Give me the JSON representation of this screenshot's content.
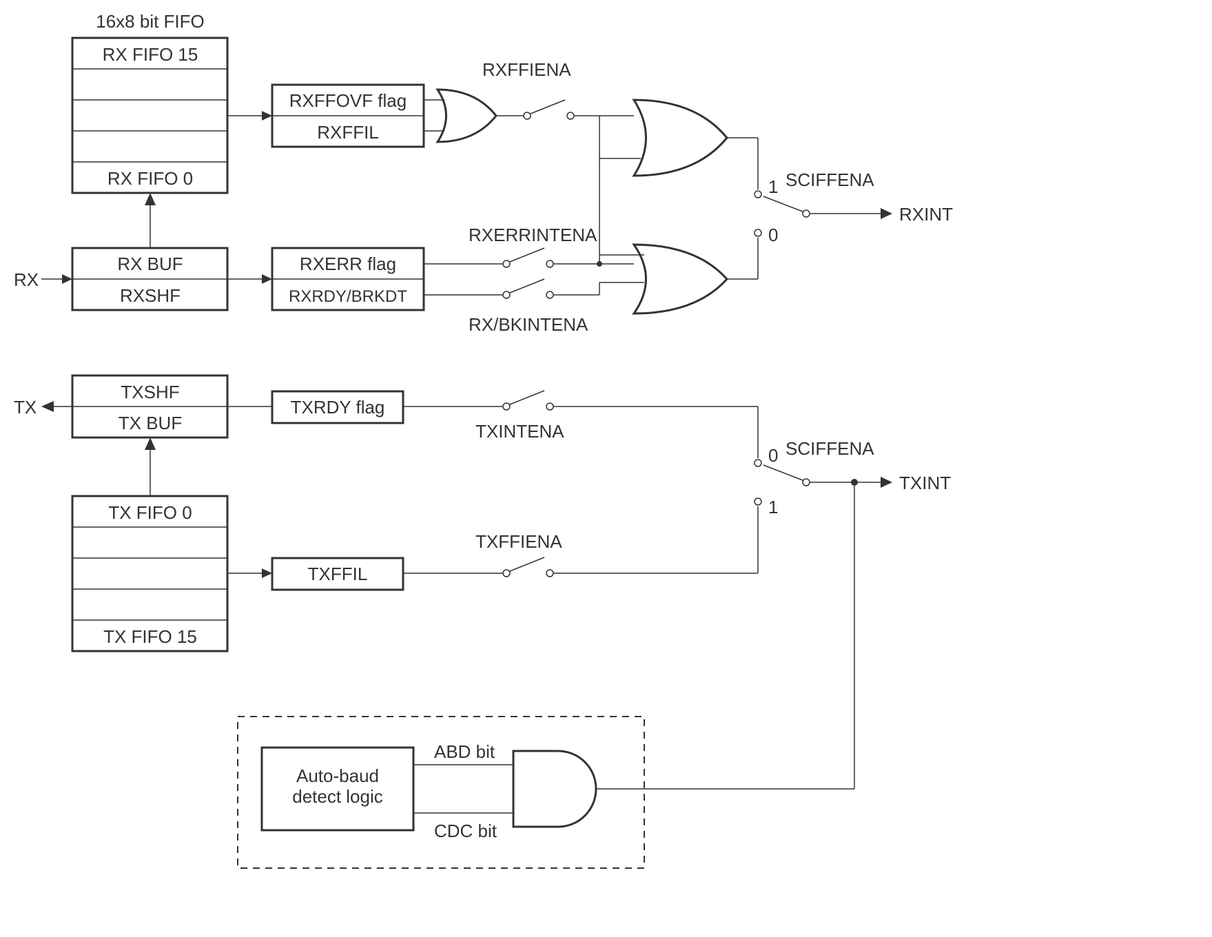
{
  "title": "16x8 bit FIFO",
  "rx_fifo": {
    "top": "RX FIFO 15",
    "bottom": "RX FIFO 0"
  },
  "rx_buf": {
    "top": "RX BUF",
    "bottom": "RXSHF"
  },
  "rx_flag_box": {
    "top": "RXFFOVF flag",
    "bottom": "RXFFIL"
  },
  "rx_err_box": {
    "top": "RXERR flag",
    "bottom": "RXRDY/BRKDT"
  },
  "tx_buf": {
    "top": "TXSHF",
    "bottom": "TX BUF"
  },
  "tx_fifo": {
    "top": "TX FIFO 0",
    "bottom": "TX FIFO 15"
  },
  "txrdy": "TXRDY flag",
  "txffil": "TXFFIL",
  "autobaud": "Auto-baud\ndetect logic",
  "labels": {
    "rx": "RX",
    "tx": "TX",
    "rxffiena": "RXFFIENA",
    "rxerrintena": "RXERRINTENA",
    "rxbkintena": "RX/BKINTENA",
    "sciffena1": "SCIFFENA",
    "sciffena2": "SCIFFENA",
    "rxint": "RXINT",
    "txint": "TXINT",
    "txintena": "TXINTENA",
    "txffiena": "TXFFIENA",
    "one1": "1",
    "zero1": "0",
    "zero2": "0",
    "one2": "1",
    "abd": "ABD bit",
    "cdc": "CDC bit"
  }
}
